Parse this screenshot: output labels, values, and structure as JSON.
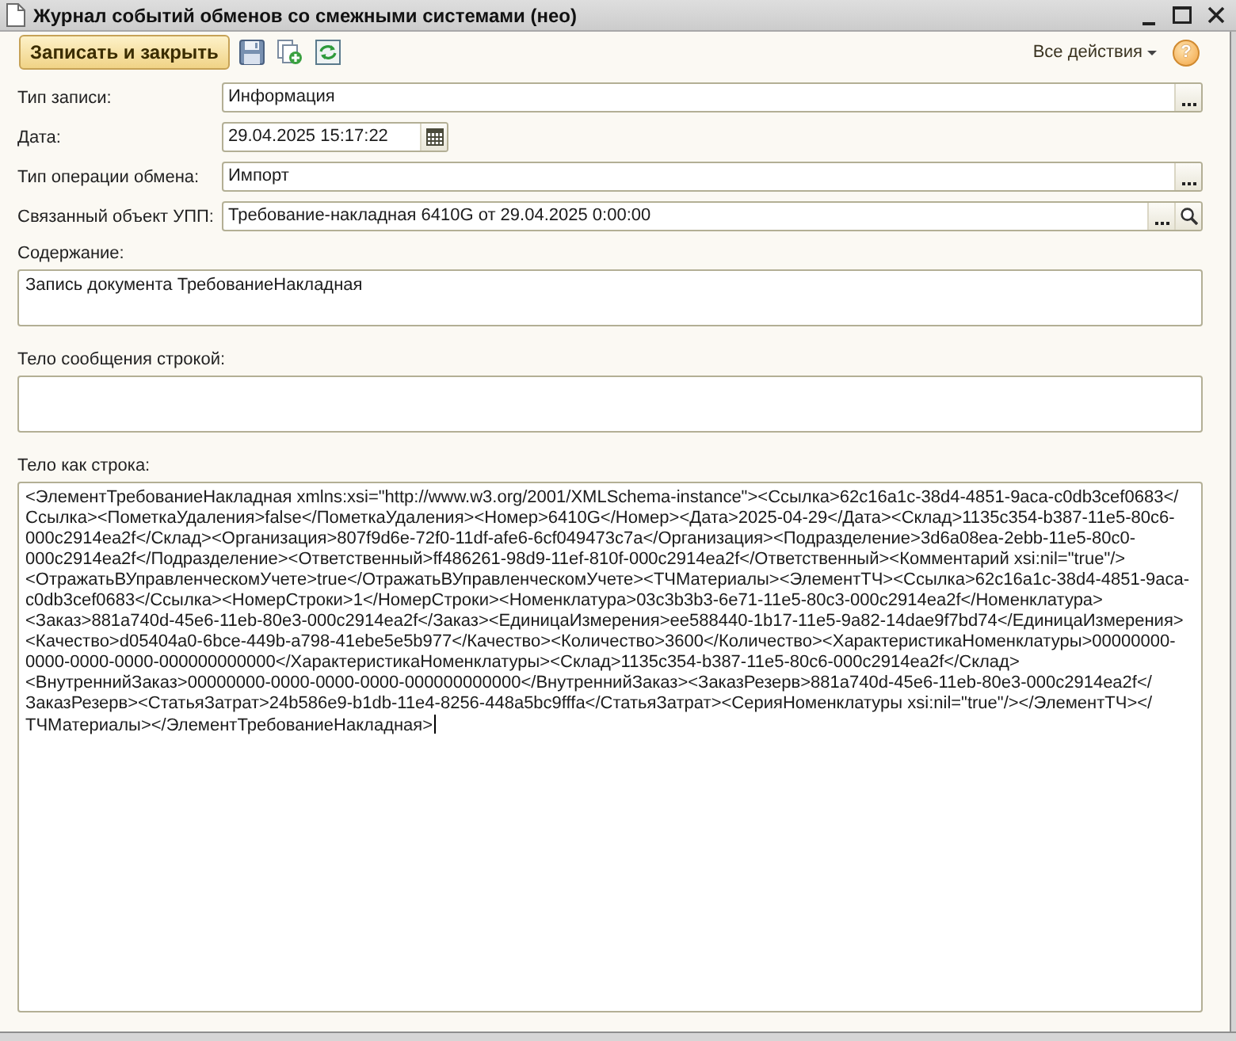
{
  "window": {
    "title": "Журнал событий обменов со смежными системами (нео)"
  },
  "toolbar": {
    "save_close_button": "Записать и закрыть",
    "all_actions_menu": "Все действия",
    "help_button": "?"
  },
  "fields": [
    {
      "kind": "choice",
      "label": "Тип записи:",
      "value": "Информация"
    },
    {
      "kind": "date",
      "label": "Дата:",
      "value": "29.04.2025 15:17:22"
    },
    {
      "kind": "choice",
      "label": "Тип операции обмена:",
      "value": "Импорт"
    },
    {
      "kind": "reference",
      "label": "Связанный объект УПП:",
      "value": "Требование-накладная 6410G от 29.04.2025 0:00:00"
    }
  ],
  "text_areas": [
    {
      "label": "Содержание:",
      "value": "Запись документа ТребованиеНакладная",
      "focused": false
    },
    {
      "label": "Тело сообщения строкой:",
      "focused": false
    },
    {
      "label": "Тело как строка:",
      "value": "<ЭлементТребованиеНакладная xmlns:xsi=\"http://www.w3.org/2001/XMLSchema-instance\"><Ссылка>62c16a1c-38d4-4851-9aca-c0db3cef0683</Ссылка><ПометкаУдаления>false</ПометкаУдаления><Номер>6410G</Номер><Дата>2025-04-29</Дата><Склад>1135c354-b387-11e5-80c6-000c2914ea2f</Склад><Организация>807f9d6e-72f0-11df-afe6-6cf049473c7a</Организация><Подразделение>3d6a08ea-2ebb-11e5-80c0-000c2914ea2f</Подразделение><Ответственный>ff486261-98d9-11ef-810f-000c2914ea2f</Ответственный><Комментарий xsi:nil=\"true\"/><ОтражатьВУправленческомУчете>true</ОтражатьВУправленческомУчете><ТЧМатериалы><ЭлементТЧ><Ссылка>62c16a1c-38d4-4851-9aca-c0db3cef0683</Ссылка><НомерСтроки>1</НомерСтроки><Номенклатура>03c3b3b3-6e71-11e5-80c3-000c2914ea2f</Номенклатура><Заказ>881a740d-45e6-11eb-80e3-000c2914ea2f</Заказ><ЕдиницаИзмерения>ee588440-1b17-11e5-9a82-14dae9f7bd74</ЕдиницаИзмерения><Качество>d05404a0-6bce-449b-a798-41ebe5e5b977</Качество><Количество>3600</Количество><ХарактеристикаНоменклатуры>00000000-0000-0000-0000-000000000000</ХарактеристикаНоменклатуры><Склад>1135c354-b387-11e5-80c6-000c2914ea2f</Склад><ВнутреннийЗаказ>00000000-0000-0000-0000-000000000000</ВнутреннийЗаказ><ЗаказРезерв>881a740d-45e6-11eb-80e3-000c2914ea2f</ЗаказРезерв><СтатьяЗатрат>24b586e9-b1db-11e4-8256-448a5bc9fffa</СтатьяЗатрат><СерияНоменклатуры xsi:nil=\"true\"/></ЭлементТЧ></ТЧМатериалы></ЭлементТребованиеНакладная>",
      "focused": true
    }
  ]
}
